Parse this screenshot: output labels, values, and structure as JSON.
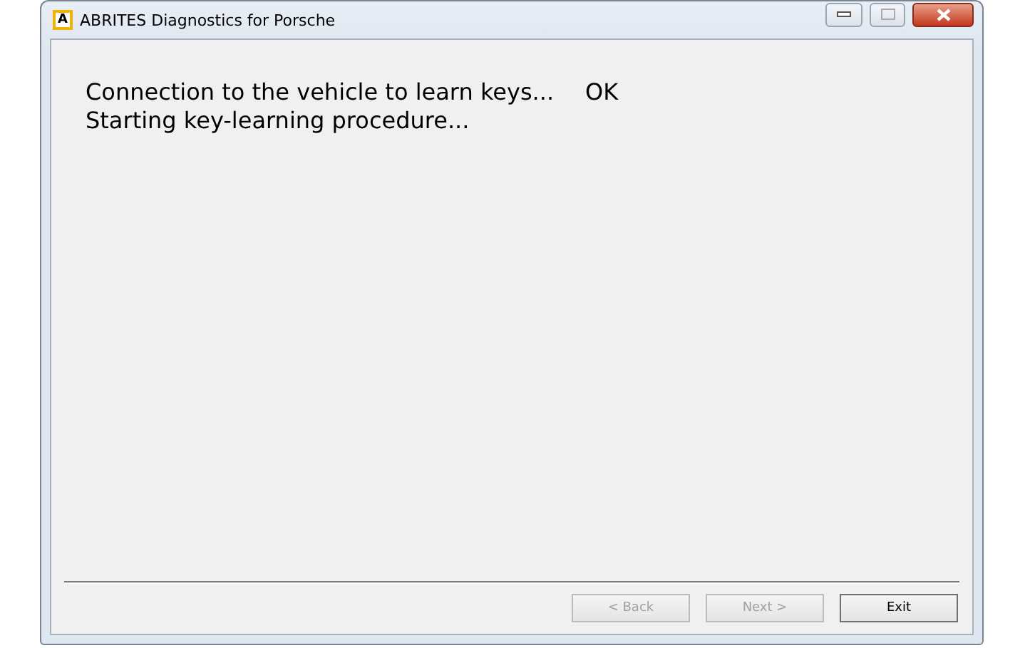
{
  "window": {
    "title": "ABRITES Diagnostics for Porsche",
    "app_icon": "A"
  },
  "log": [
    {
      "text": "Connection to the vehicle to learn keys...",
      "status": "OK"
    },
    {
      "text": "Starting key-learning procedure..."
    }
  ],
  "buttons": [
    {
      "label": "< Back",
      "disabled": true
    },
    {
      "label": "Next >",
      "disabled": true
    },
    {
      "label": "Exit",
      "disabled": false
    }
  ]
}
